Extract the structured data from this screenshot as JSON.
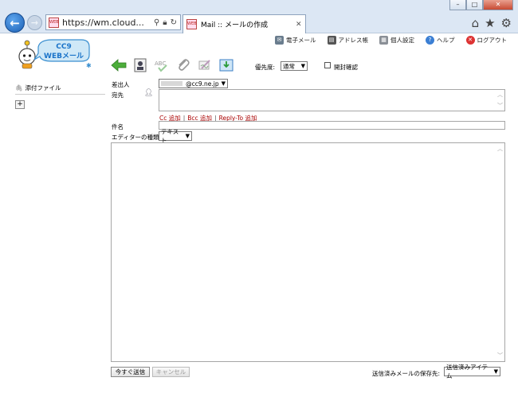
{
  "browser": {
    "address_url": "https://wm.cloud...",
    "tab_title": "Mail :: メールの作成",
    "favicon_text": "WEB"
  },
  "brand": {
    "logo_top": "CC9",
    "logo_bottom": "WEBメール"
  },
  "toplinks": [
    {
      "label": "電子メール",
      "icon": "mail-icon"
    },
    {
      "label": "アドレス帳",
      "icon": "addressbook-icon"
    },
    {
      "label": "個人設定",
      "icon": "settings-icon"
    },
    {
      "label": "ヘルプ",
      "icon": "help-icon"
    },
    {
      "label": "ログアウト",
      "icon": "logout-icon"
    }
  ],
  "toolbar": {
    "priority_label": "優先度:",
    "priority_value": "通常",
    "read_receipt_label": "開封確認"
  },
  "sidebar": {
    "attach_label": "添付ファイル",
    "add_label": "+"
  },
  "compose": {
    "from_label": "差出人",
    "from_value": "@cc9.ne.jp",
    "to_label": "宛先",
    "cc_add": "Cc 追加",
    "bcc_add": "Bcc 追加",
    "replyto_add": "Reply-To 追加",
    "subject_label": "件名",
    "editor_label": "エディターの種類",
    "editor_value": "テキスト"
  },
  "footer": {
    "send_now": "今すぐ送信",
    "cancel": "キャンセル",
    "save_sent_label": "送信済みメールの保存先:",
    "save_sent_value": "送信済みアイテム"
  },
  "colors": {
    "link_red": "#aa0000",
    "back_blue": "#1a5fb4"
  }
}
